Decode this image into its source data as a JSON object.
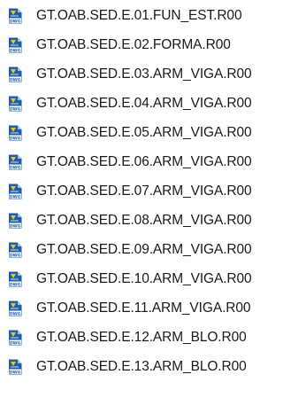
{
  "file_list": {
    "icon": "dwg-file-icon",
    "icon_label": "DWG",
    "items": [
      {
        "name": "GT.OAB.SED.E.01.FUN_EST.R00"
      },
      {
        "name": "GT.OAB.SED.E.02.FORMA.R00"
      },
      {
        "name": "GT.OAB.SED.E.03.ARM_VIGA.R00"
      },
      {
        "name": "GT.OAB.SED.E.04.ARM_VIGA.R00"
      },
      {
        "name": "GT.OAB.SED.E.05.ARM_VIGA.R00"
      },
      {
        "name": "GT.OAB.SED.E.06.ARM_VIGA.R00"
      },
      {
        "name": "GT.OAB.SED.E.07.ARM_VIGA.R00"
      },
      {
        "name": "GT.OAB.SED.E.08.ARM_VIGA.R00"
      },
      {
        "name": "GT.OAB.SED.E.09.ARM_VIGA.R00"
      },
      {
        "name": "GT.OAB.SED.E.10.ARM_VIGA.R00"
      },
      {
        "name": "GT.OAB.SED.E.11.ARM_VIGA.R00"
      },
      {
        "name": "GT.OAB.SED.E.12.ARM_BLO.R00"
      },
      {
        "name": "GT.OAB.SED.E.13.ARM_BLO.R00"
      }
    ]
  },
  "colors": {
    "icon_body": "#1f5fa8",
    "icon_accent": "#f0c419",
    "text": "#1a1a1a"
  }
}
